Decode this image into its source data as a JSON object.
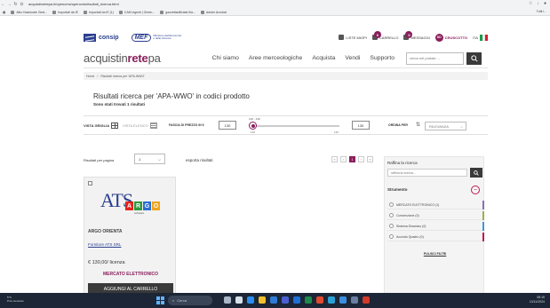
{
  "browser": {
    "url": "acquistinretepa.it/opencms/opencms/risultati_ricerca.html",
    "bookmarks": [
      "Albo Nazionale Gest...",
      "Importati da IE",
      "Importati da IE (1)",
      "CAM vigenti | Green...",
      "gazzettaufficiale.it/a...",
      "Adobe Acrobat"
    ],
    "all_bookmarks_label": "Tutti i..."
  },
  "topbar": {
    "consip_label": "consip",
    "mef_label": "MEF",
    "mef_sub": "Ministero dell'Economia e delle Finanze",
    "liste_label": "LISTE MIOPI",
    "carrello_label": "CARRELLO",
    "carrello_count": "0",
    "messaggi_label": "MESSAGGI",
    "messaggi_count": "0",
    "cruscotto_label": "CRUSCOTTO",
    "cruscotto_initials": "DD",
    "lang_label": "ITA"
  },
  "mainnav": {
    "brand_a": "acquistin",
    "brand_b": "rete",
    "brand_c": "pa",
    "links": [
      "Chi siamo",
      "Aree merceologiche",
      "Acquista",
      "Vendi",
      "Supporto"
    ],
    "search_placeholder": "cerca nel portale ..."
  },
  "breadcrumb": {
    "home": "Home",
    "sep": "/",
    "current": "Risultati ricerca per 'APA-WWO'"
  },
  "results": {
    "heading": "Risultati ricerca per 'APA-WWO' in codici prodotto",
    "count_text": "Sono stati trovati 1 risultati"
  },
  "filters": {
    "vista_griglia": "VISTA GRIGLIA",
    "vista_elenco": "VISTA ELENCO",
    "fascia_label": "FASCIA DI PREZZO IN €",
    "price_min": "130",
    "price_max": "130",
    "slider_label": "130 - 130",
    "slider_min_tick": "130",
    "slider_max_tick": "130",
    "ordina_label": "ORDINA PER",
    "sort_value": "RILEVANZA"
  },
  "listing": {
    "perpage_label": "Risultati per pagina",
    "perpage_value": "1",
    "export_label": "esporta risultati",
    "pages": [
      "«",
      "‹",
      "1",
      "›",
      "»"
    ],
    "current_page": "1"
  },
  "product": {
    "logo_text": "ATS",
    "logo_sub": [
      "A",
      "R",
      "G",
      "O"
    ],
    "logo_caption": "software",
    "name": "ARGO ORIENTA",
    "company": "Fornitore ATS SRL",
    "price": "€ 130,00/ licenza",
    "channel": "MERCATO ELETTRONICO",
    "add_to_cart": "AGGIUNGI AL CARRELLO"
  },
  "refine": {
    "title": "Raffina la ricerca",
    "search_placeholder": "raffina la ricerca...",
    "section_title": "Strumento",
    "options": [
      {
        "label": "MERCATO ELETTRONICO (1)",
        "color": "#8a6fb0"
      },
      {
        "label": "Convenzione (0)",
        "color": "#9ab04a"
      },
      {
        "label": "Sistema Dinamico (0)",
        "color": "#3a9ad6"
      },
      {
        "label": "Accordo Quadro (0)",
        "color": "#c0184f"
      }
    ],
    "clear_label": "PULISCI FILTRI"
  },
  "taskbar": {
    "weather_temp": "5°C",
    "weather_text": "Prev.nuvoloso",
    "search_label": "Cerca",
    "time": "08:15",
    "date": "13/11/2024"
  }
}
